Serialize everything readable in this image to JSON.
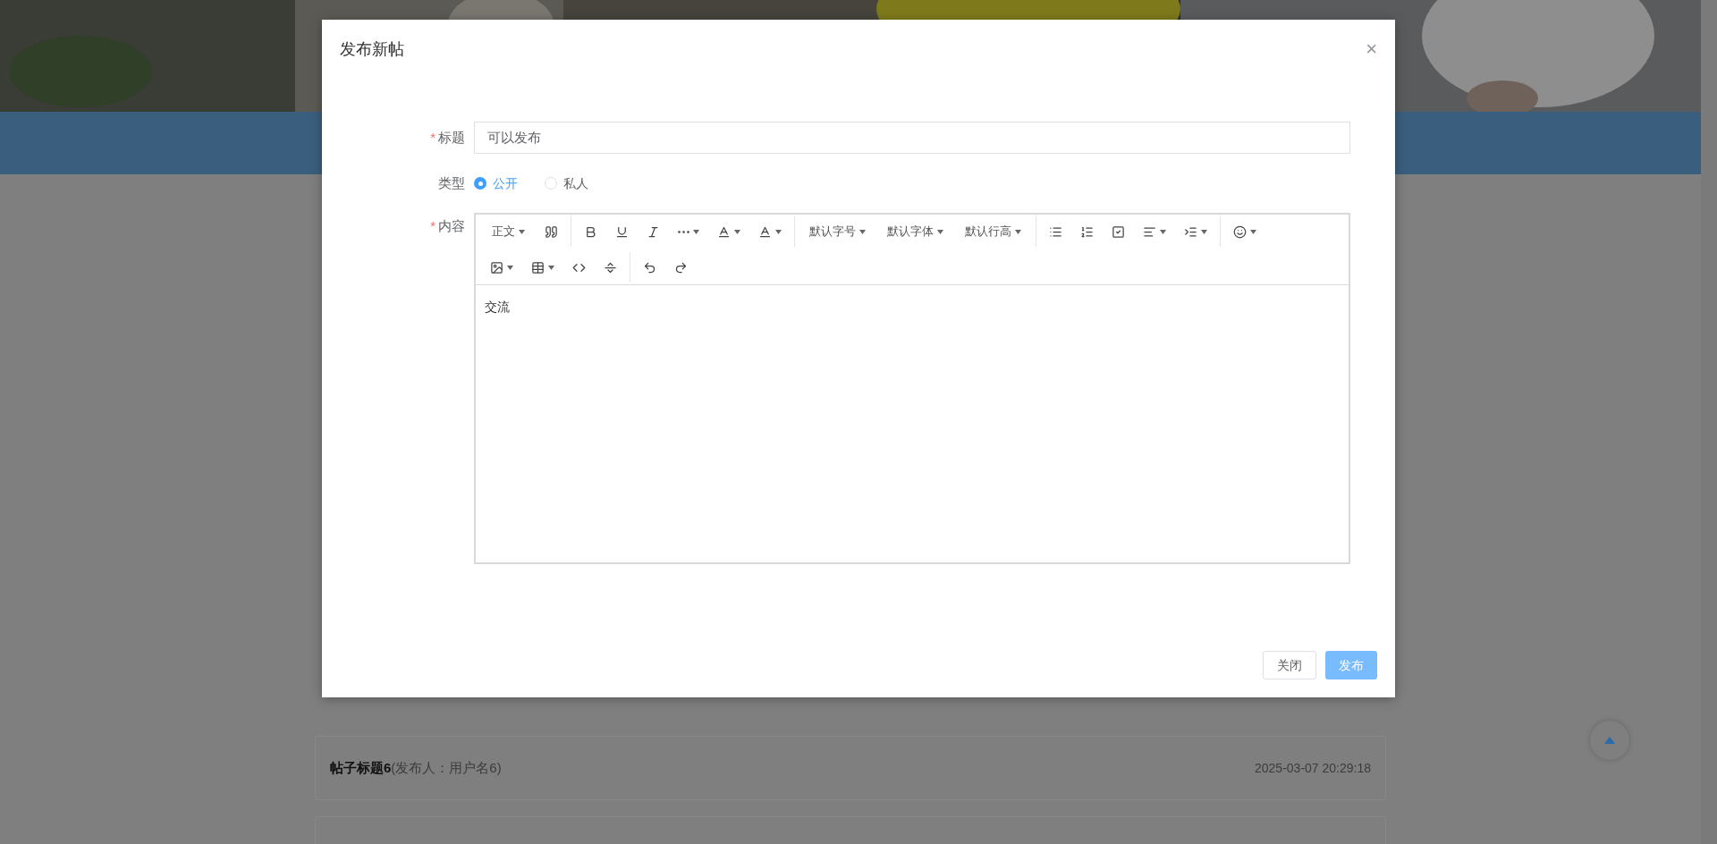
{
  "background": {
    "posts": [
      {
        "title": "帖子标题6",
        "author": "(发布人：用户名6)",
        "time": "2025-03-07 20:29:18"
      }
    ]
  },
  "dialog": {
    "title": "发布新帖",
    "close": "×",
    "title_field": {
      "required_mark": "*",
      "label": "标题",
      "value": "可以发布"
    },
    "type_field": {
      "label": "类型",
      "options": [
        {
          "label": "公开",
          "selected": true
        },
        {
          "label": "私人",
          "selected": false
        }
      ]
    },
    "content_field": {
      "required_mark": "*",
      "label": "内容",
      "toolbar_texts": [
        "正文",
        "默认字号",
        "默认字体",
        "默认行高"
      ],
      "value": "交流"
    },
    "buttons": [
      {
        "label": "关闭",
        "kind": "default"
      },
      {
        "label": "发布",
        "kind": "primary"
      }
    ]
  }
}
